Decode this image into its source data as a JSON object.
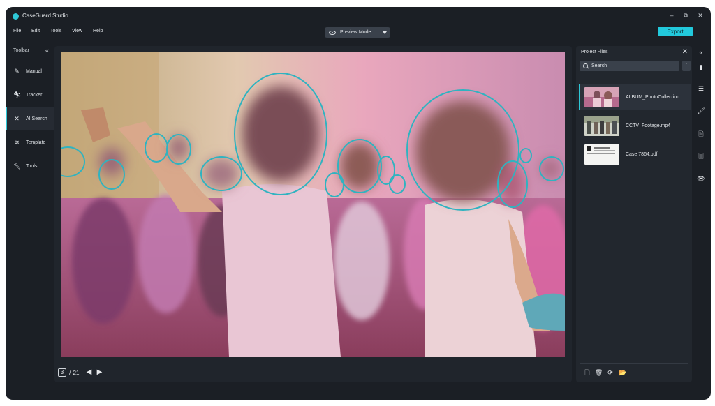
{
  "app": {
    "title": "CaseGuard Studio"
  },
  "window_controls": {
    "minimize": "–",
    "maximize": "⧉",
    "close": "✕"
  },
  "menu": [
    {
      "label": "File"
    },
    {
      "label": "Edit"
    },
    {
      "label": "Tools"
    },
    {
      "label": "View"
    },
    {
      "label": "Help"
    }
  ],
  "mode_selector": {
    "value": "Preview Mode"
  },
  "export": {
    "label": "Export"
  },
  "toolbar": {
    "title": "Toolbar",
    "collapse_glyph": "«",
    "items": [
      {
        "label": "Manual",
        "icon": "pen-icon",
        "glyph": "✎",
        "active": false
      },
      {
        "label": "Tracker",
        "icon": "running-person-icon",
        "glyph": "🏃︎",
        "active": false
      },
      {
        "label": "AI Search",
        "icon": "magic-wand-icon",
        "glyph": "✕",
        "active": true
      },
      {
        "label": "Template",
        "icon": "layers-icon",
        "glyph": "≋",
        "active": false
      },
      {
        "label": "Tools",
        "icon": "wrench-icon",
        "glyph": "🔧︎",
        "active": false
      }
    ]
  },
  "pager": {
    "current": "3",
    "separator": "/",
    "total": "21",
    "prev_glyph": "◀",
    "next_glyph": "▶"
  },
  "project_panel": {
    "title": "Project Files",
    "close_glyph": "✕",
    "search": {
      "placeholder": "Search"
    },
    "more_glyph": "⋮",
    "files": [
      {
        "name": "ALBUM_PhotoCollection",
        "active": true
      },
      {
        "name": "CCTV_Footage.mp4",
        "active": false
      },
      {
        "name": "Case 7864.pdf",
        "active": false
      }
    ],
    "footer_icons": [
      {
        "icon": "new-file-icon",
        "glyph": "🗋"
      },
      {
        "icon": "trash-icon",
        "glyph": "🗑"
      },
      {
        "icon": "sync-icon",
        "glyph": "⟳"
      },
      {
        "icon": "folder-open-icon",
        "glyph": "📂"
      }
    ]
  },
  "right_rail": [
    {
      "icon": "collapse-icon",
      "glyph": "«"
    },
    {
      "icon": "copy-icon",
      "glyph": "▮"
    },
    {
      "icon": "checklist-icon",
      "glyph": "☰"
    },
    {
      "icon": "brush-icon",
      "glyph": "🖌"
    },
    {
      "icon": "file-info-icon",
      "glyph": "🗎"
    },
    {
      "icon": "document-icon",
      "glyph": "🗏"
    },
    {
      "icon": "eye-icon",
      "glyph": "👁"
    }
  ],
  "colors": {
    "accent": "#22c9dc",
    "window_bg": "#1b1f25",
    "panel_bg": "#22272e",
    "redaction_ring": "#2fb3c0"
  }
}
